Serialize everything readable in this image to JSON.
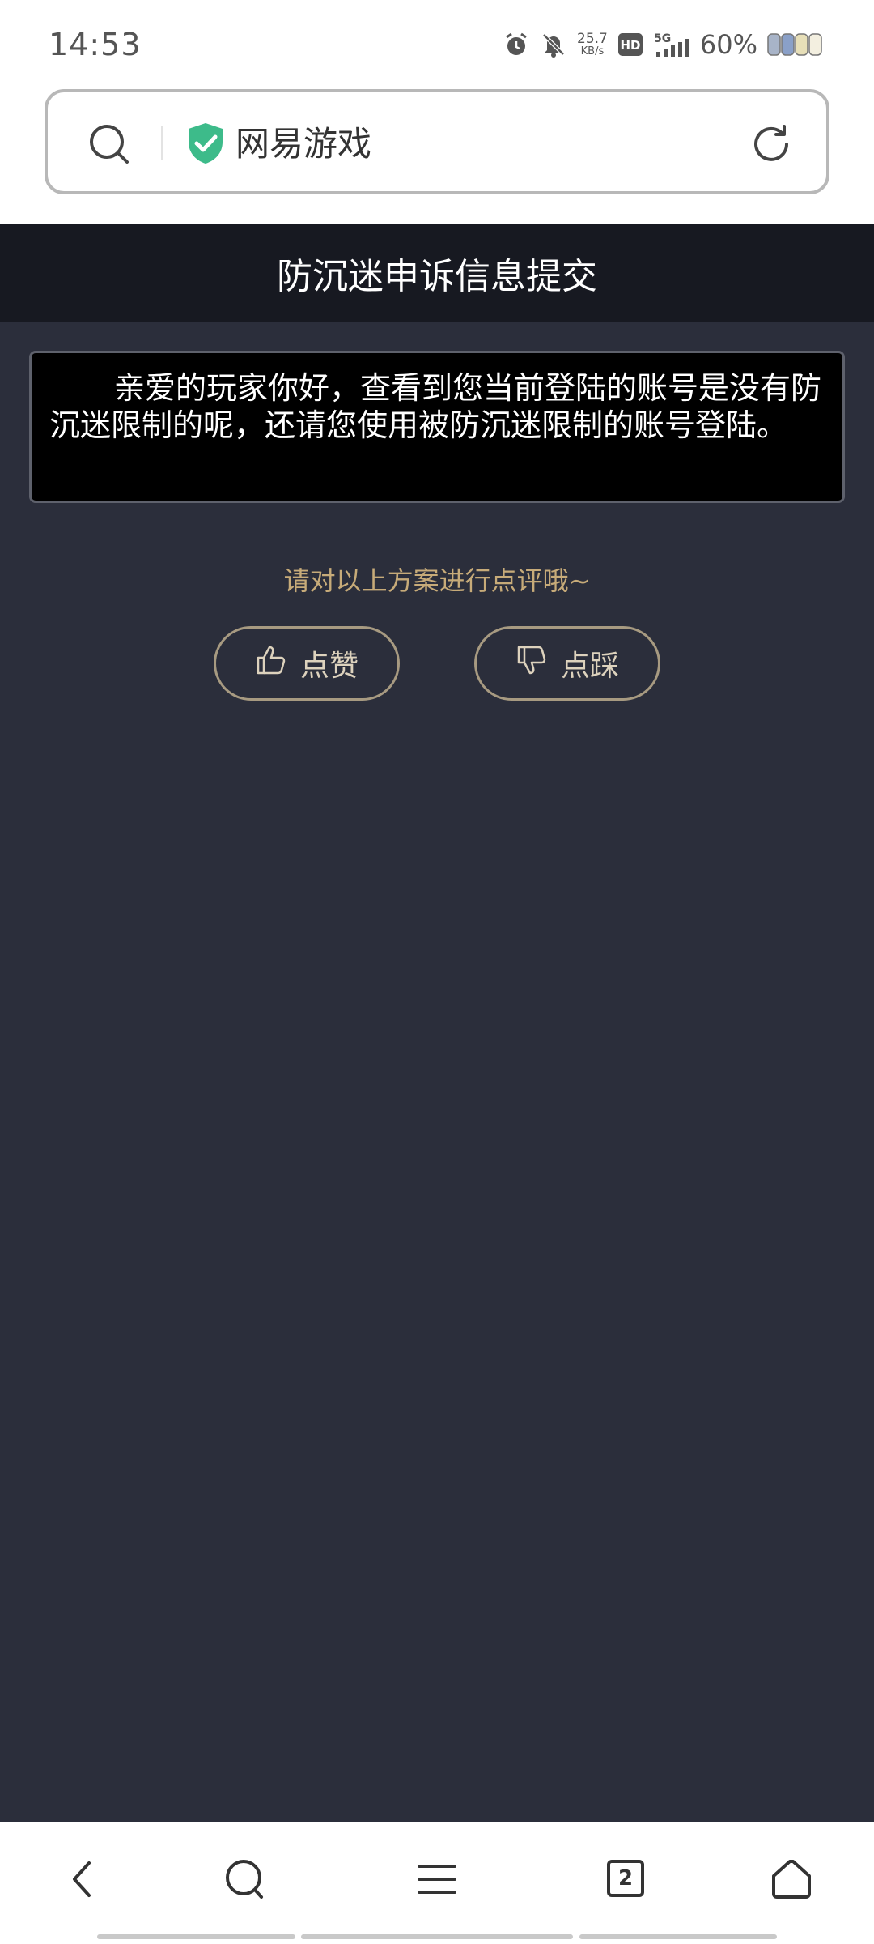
{
  "status_bar": {
    "time": "14:53",
    "net_speed_value": "25.7",
    "net_speed_unit": "KB/s",
    "hd_label": "HD",
    "network_label": "5G",
    "battery_percent": "60%"
  },
  "url_bar": {
    "site_name": "网易游戏"
  },
  "page": {
    "title": "防沉迷申诉信息提交",
    "message": "亲爱的玩家你好，查看到您当前登陆的账号是没有防沉迷限制的呢，还请您使用被防沉迷限制的账号登陆。",
    "rate_prompt": "请对以上方案进行点评哦~",
    "like_label": "点赞",
    "dislike_label": "点踩"
  },
  "bottom_nav": {
    "tab_count": "2"
  },
  "colors": {
    "title_bar_bg": "#171921",
    "content_bg": "#2b2e3b",
    "accent_gold": "#c7ab79",
    "shield_green": "#3dbb8a"
  },
  "icons": [
    "alarm-icon",
    "mute-bell-icon",
    "hd-icon",
    "signal-icon",
    "battery-icon",
    "search-icon",
    "verified-shield-icon",
    "reload-icon",
    "thumbs-up-icon",
    "thumbs-down-icon",
    "back-icon",
    "search-nav-icon",
    "menu-icon",
    "tabs-icon",
    "home-icon"
  ]
}
